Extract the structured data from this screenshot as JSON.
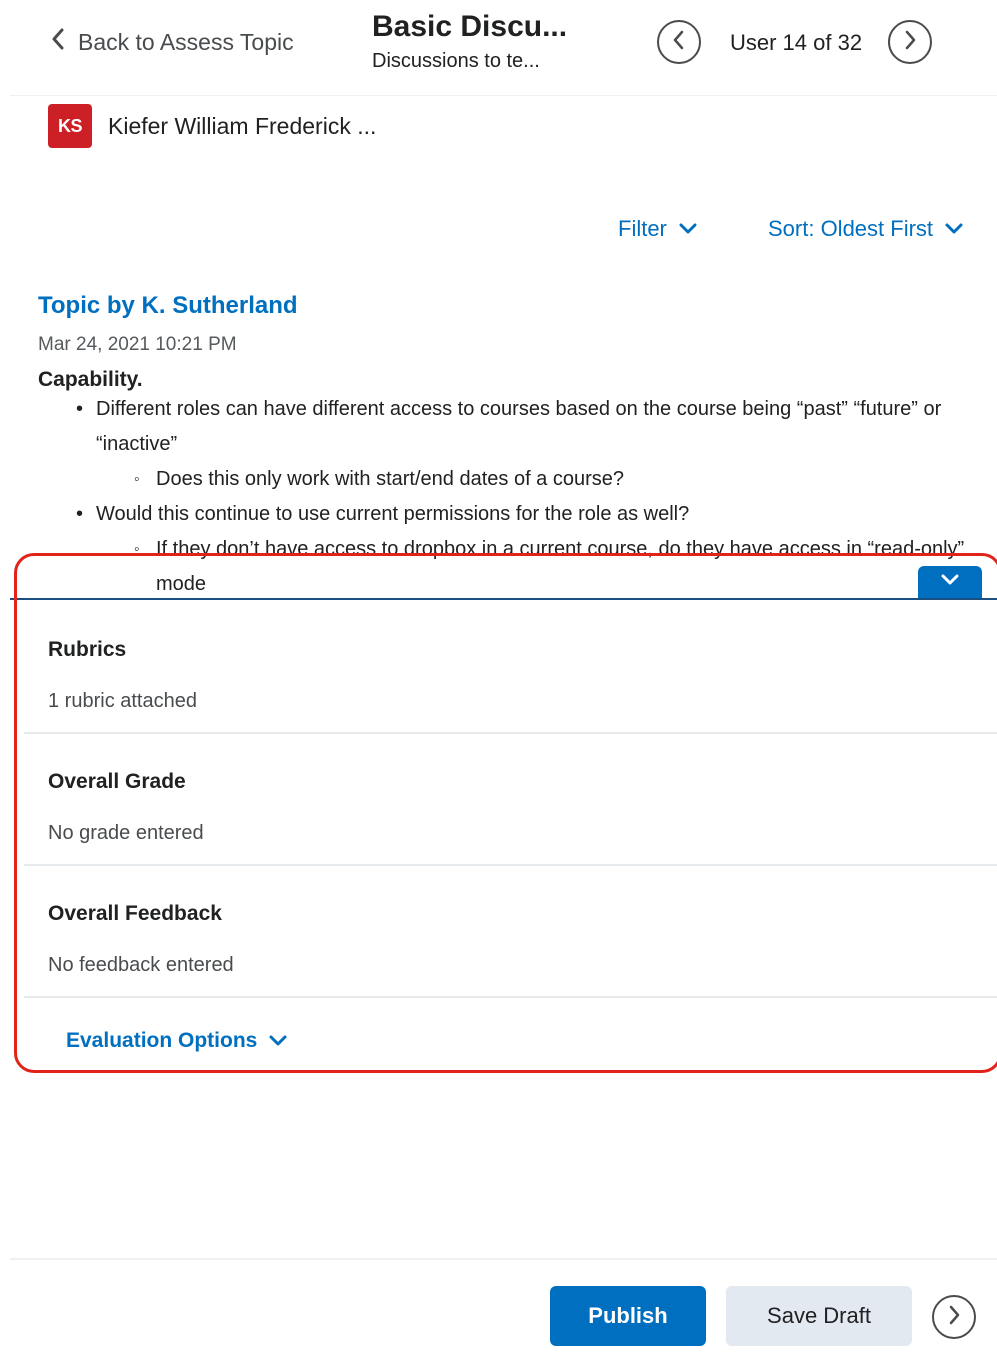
{
  "header": {
    "back_label": "Back to Assess Topic",
    "title": "Basic Discu...",
    "subtitle": "Discussions to te...",
    "user_count": "User 14 of 32"
  },
  "user": {
    "initials": "KS",
    "name": "Kiefer William Frederick ...",
    "avatar_color": "#cd2026"
  },
  "toolbar": {
    "filter_label": "Filter",
    "sort_label": "Sort: Oldest First"
  },
  "post": {
    "author": "Topic by K. Sutherland",
    "date": "Mar 24, 2021 10:21 PM",
    "heading": "Capability.",
    "bullets": [
      "Different roles can have different access to courses based on the course being “past” “future” or “inactive”",
      "Does this only work with start/end dates of a course?",
      "Would this continue to use current permissions for the role as well?",
      "If they don’t have access to dropbox in a current course, do they have access in “read-only” mode"
    ]
  },
  "evaluation": {
    "rubrics_label": "Rubrics",
    "rubrics_value": "1 rubric attached",
    "grade_label": "Overall Grade",
    "grade_value": "No grade entered",
    "feedback_label": "Overall Feedback",
    "feedback_value": "No feedback entered",
    "options_label": "Evaluation Options"
  },
  "footer": {
    "publish_label": "Publish",
    "draft_label": "Save Draft"
  },
  "colors": {
    "accent": "#006fbf",
    "highlight_border": "#e2231a"
  }
}
